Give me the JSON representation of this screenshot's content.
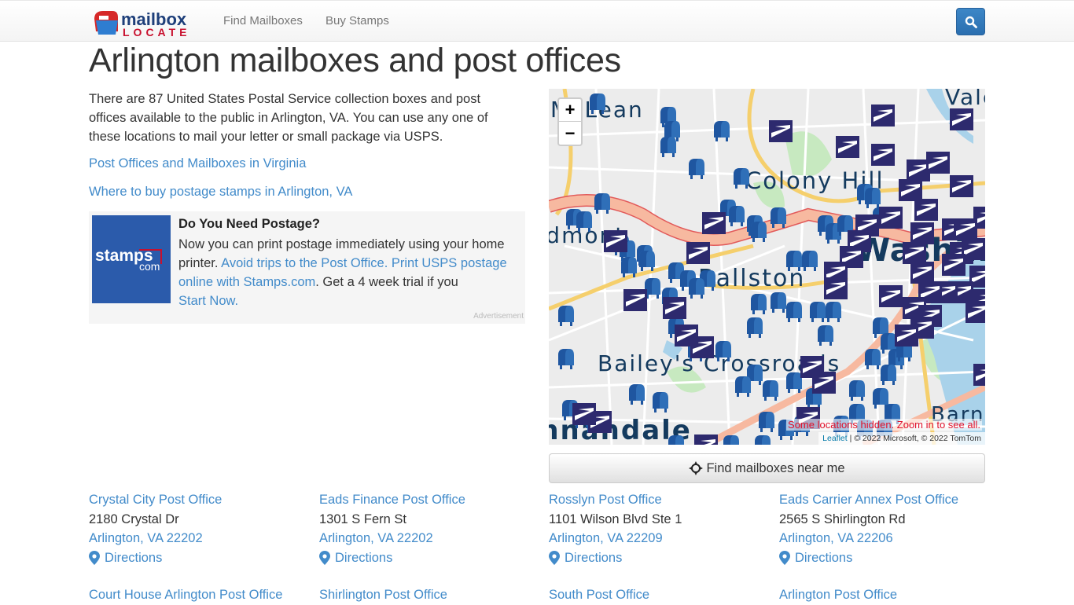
{
  "header": {
    "logo_top": "mailbox",
    "logo_bottom": "LOCATE",
    "nav": [
      {
        "label": "Find Mailboxes"
      },
      {
        "label": "Buy Stamps"
      }
    ],
    "search_icon": "search-icon"
  },
  "page": {
    "title": "Arlington mailboxes and post offices",
    "intro": "There are 87 United States Postal Service collection boxes and post offices available to the public in Arlington, VA. You can use any one of these locations to mail your letter or small package via USPS.",
    "links": [
      {
        "label": "Post Offices and Mailboxes in Virginia"
      },
      {
        "label": "Where to buy postage stamps in Arlington, VA"
      }
    ]
  },
  "ad": {
    "image_text": "stamps",
    "image_sub": "com",
    "title": "Do You Need Postage?",
    "body_start": "Now you can print postage immediately using your home printer. ",
    "body_link": "Avoid trips to the Post Office. Print USPS postage online with Stamps.com",
    "body_mid": ". Get a 4 week trial if you ",
    "cta": "Start Now.",
    "label": "Advertisement"
  },
  "map": {
    "zoom_in": "+",
    "zoom_out": "−",
    "place_labels": [
      "McLean",
      "Colony Hill",
      "Ballston",
      "Washington",
      "Bailey's Crossroads",
      "Annandale",
      "Barnaby",
      "Vale",
      "Woodmont"
    ],
    "hidden_note": "Some locations hidden. Zoom in to see all.",
    "attribution_link": "Leaflet",
    "attribution_text": " | © 2022 Microsoft, © 2022 TomTom",
    "colors": {
      "mailbox": "#2f6fb8",
      "post_office": "#2d2a6e",
      "highway": "#f7b9a0",
      "major_road": "#f5cf6c",
      "water": "#a9d2ea",
      "park": "#c7e9c0"
    }
  },
  "near_button": {
    "icon": "crosshair-icon",
    "label": "Find mailboxes near me"
  },
  "offices": [
    {
      "name": "Crystal City Post Office",
      "address": "2180 Crystal Dr",
      "city": "Arlington, VA 22202",
      "directions": "Directions"
    },
    {
      "name": "Eads Finance Post Office",
      "address": "1301 S Fern St",
      "city": "Arlington, VA 22202",
      "directions": "Directions"
    },
    {
      "name": "Rosslyn Post Office",
      "address": "1101 Wilson Blvd Ste 1",
      "city": "Arlington, VA 22209",
      "directions": "Directions"
    },
    {
      "name": "Eads Carrier Annex Post Office",
      "address": "2565 S Shirlington Rd",
      "city": "Arlington, VA 22206",
      "directions": "Directions"
    },
    {
      "name": "Court House Arlington Post Office"
    },
    {
      "name": "Shirlington Post Office"
    },
    {
      "name": "South Post Office"
    },
    {
      "name": "Arlington Post Office"
    }
  ]
}
